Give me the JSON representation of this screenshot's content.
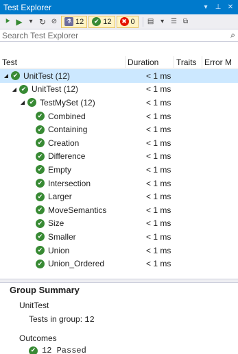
{
  "window": {
    "title": "Test Explorer",
    "pin_icon": "pin-icon",
    "close_icon": "close-icon"
  },
  "toolbar": {
    "buttons": [
      "run-all-icon",
      "run-icon",
      "dropdown-icon",
      "refresh-icon",
      "cancel-icon"
    ],
    "total_count": "12",
    "passed_count": "12",
    "failed_count": "0"
  },
  "search": {
    "placeholder": "Search Test Explorer"
  },
  "columns": {
    "test": "Test",
    "duration": "Duration",
    "traits": "Traits",
    "error": "Error M"
  },
  "tree": [
    {
      "name": "UnitTest (12)",
      "duration": "< 1 ms",
      "depth": 0,
      "expanded": true,
      "selected": true
    },
    {
      "name": "UnitTest (12)",
      "duration": "< 1 ms",
      "depth": 1,
      "expanded": true
    },
    {
      "name": "TestMySet (12)",
      "duration": "< 1 ms",
      "depth": 2,
      "expanded": true
    },
    {
      "name": "Combined",
      "duration": "< 1 ms",
      "depth": 3
    },
    {
      "name": "Containing",
      "duration": "< 1 ms",
      "depth": 3
    },
    {
      "name": "Creation",
      "duration": "< 1 ms",
      "depth": 3
    },
    {
      "name": "Difference",
      "duration": "< 1 ms",
      "depth": 3
    },
    {
      "name": "Empty",
      "duration": "< 1 ms",
      "depth": 3
    },
    {
      "name": "Intersection",
      "duration": "< 1 ms",
      "depth": 3
    },
    {
      "name": "Larger",
      "duration": "< 1 ms",
      "depth": 3
    },
    {
      "name": "MoveSemantics",
      "duration": "< 1 ms",
      "depth": 3
    },
    {
      "name": "Size",
      "duration": "< 1 ms",
      "depth": 3
    },
    {
      "name": "Smaller",
      "duration": "< 1 ms",
      "depth": 3
    },
    {
      "name": "Union",
      "duration": "< 1 ms",
      "depth": 3
    },
    {
      "name": "Union_Ordered",
      "duration": "< 1 ms",
      "depth": 3
    }
  ],
  "summary": {
    "title": "Group Summary",
    "group_name": "UnitTest",
    "tests_label": "Tests in group:",
    "tests_count": "12",
    "outcomes_label": "Outcomes",
    "passed_text": "12 Passed"
  },
  "colors": {
    "titlebar": "#007acc",
    "passed": "#388a34",
    "failed": "#e51400",
    "selected_row": "#cce8ff"
  }
}
